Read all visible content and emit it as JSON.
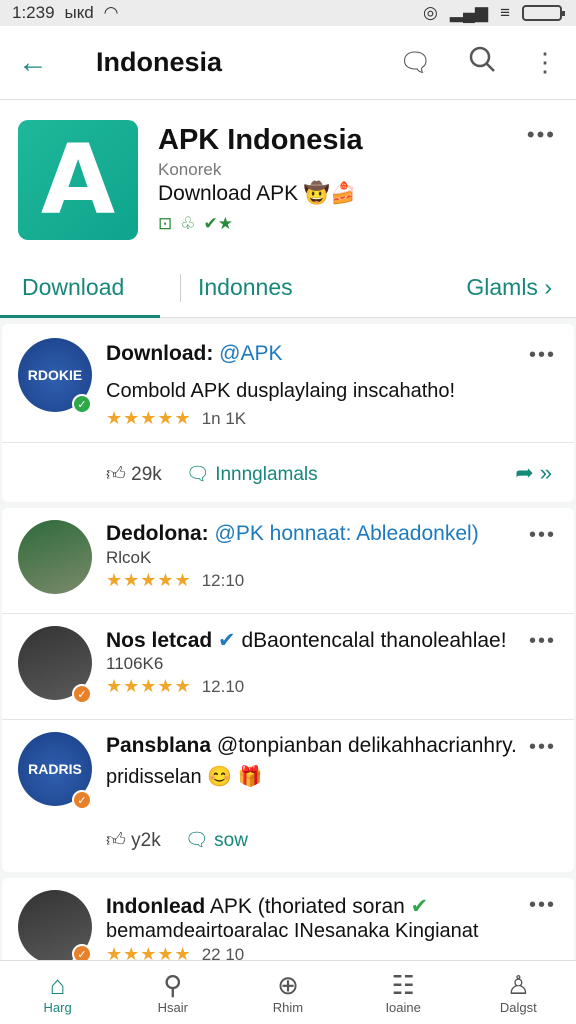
{
  "status": {
    "time": "1:239",
    "carrier": "ыкd"
  },
  "app_bar": {
    "title": "Indonesia"
  },
  "app": {
    "name": "APK Indonesia",
    "developer": "Konorek",
    "subtitle": "Download APK 🤠🍰",
    "icon_letter": "A"
  },
  "tabs": [
    {
      "label": "Download"
    },
    {
      "label": "Indonnes"
    },
    {
      "label": "Glamls ›"
    }
  ],
  "posts": [
    {
      "name": "Download:",
      "handle": "@APK",
      "body": "Combold APK dusplaylaing inscahatho!",
      "rating_count": "1n 1K",
      "avatar_text": "RDOKIE",
      "likes": "29k",
      "comment_label": "Innnglamals"
    },
    {
      "name": "Dedolona:",
      "handle": "@PK honnaat: Ableadonkel)",
      "sub": "RlcoK",
      "rating_count": "12:10"
    },
    {
      "name": "Nos letcad",
      "handle": "dBaontencalal thanoleahlae!",
      "sub": "1106K6",
      "rating_count": "12.10"
    },
    {
      "name": "Pansblana",
      "handle": "@tonpianban delikahhacrianhry.",
      "body": "pridisselan",
      "avatar_text": "RADRIS",
      "likes": "y2k",
      "comment_label": "sow"
    },
    {
      "name": "Indonlead",
      "handle": "APK (thoriated soran",
      "body": "bemamdeairtoaralac INesanaka Kingianat",
      "rating_count": "22 10"
    }
  ],
  "bottom_nav": [
    {
      "label": "Harg",
      "icon": "home-icon"
    },
    {
      "label": "Hsair",
      "icon": "search-icon"
    },
    {
      "label": "Rhim",
      "icon": "compass-icon"
    },
    {
      "label": "Ioaine",
      "icon": "list-icon"
    },
    {
      "label": "Dalgst",
      "icon": "profile-icon"
    }
  ],
  "colors": {
    "accent": "#17877a",
    "star": "#efa62a",
    "link": "#1e7abd"
  }
}
